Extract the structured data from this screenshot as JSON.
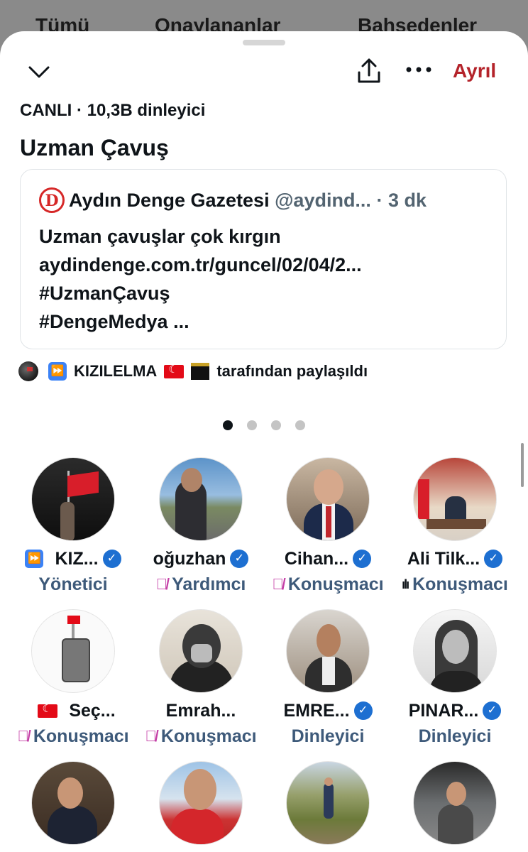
{
  "background_tabs": [
    "Tümü",
    "Onaylananlar",
    "Bahsedenler"
  ],
  "header": {
    "leave_label": "Ayrıl",
    "status": "CANLI · 10,3B dinleyici",
    "title": "Uzman Çavuş"
  },
  "pinned_post": {
    "author_name": "Aydın Denge Gazetesi",
    "author_handle": "@aydind...",
    "time": "· 3 dk",
    "logo_letter": "D",
    "lines": [
      "Uzman çavuşlar çok kırgın",
      "aydindenge.com.tr/guncel/02/04/2...",
      "#UzmanÇavuş",
      "#DengeMedya ..."
    ]
  },
  "shared_by": {
    "name": "KIZILELMA",
    "suffix": "tarafından paylaşıldı"
  },
  "pager": {
    "count": 4,
    "active": 0
  },
  "participants": [
    {
      "name": "KIZ...",
      "role": "Yönetici",
      "verified": true,
      "ff_prefix": true,
      "flag_prefix": false,
      "icon": "none"
    },
    {
      "name": "oğuzhan",
      "role": "Yardımcı",
      "verified": true,
      "ff_prefix": false,
      "flag_prefix": false,
      "icon": "muted-mic"
    },
    {
      "name": "Cihan...",
      "role": "Konuşmacı",
      "verified": true,
      "ff_prefix": false,
      "flag_prefix": false,
      "icon": "muted-mic"
    },
    {
      "name": "Ali Tilk...",
      "role": "Konuşmacı",
      "verified": true,
      "ff_prefix": false,
      "flag_prefix": false,
      "icon": "speaking"
    },
    {
      "name": "Seç...",
      "role": "Konuşmacı",
      "verified": false,
      "ff_prefix": false,
      "flag_prefix": true,
      "icon": "muted-mic"
    },
    {
      "name": "Emrah...",
      "role": "Konuşmacı",
      "verified": false,
      "ff_prefix": false,
      "flag_prefix": false,
      "icon": "muted-mic"
    },
    {
      "name": "EMRE...",
      "role": "Dinleyici",
      "verified": true,
      "ff_prefix": false,
      "flag_prefix": false,
      "icon": "none"
    },
    {
      "name": "PINAR...",
      "role": "Dinleyici",
      "verified": true,
      "ff_prefix": false,
      "flag_prefix": false,
      "icon": "none"
    },
    {
      "name": "",
      "role": "",
      "verified": false,
      "ff_prefix": false,
      "flag_prefix": false,
      "icon": "none"
    },
    {
      "name": "",
      "role": "",
      "verified": false,
      "ff_prefix": false,
      "flag_prefix": false,
      "icon": "none"
    },
    {
      "name": "",
      "role": "",
      "verified": false,
      "ff_prefix": false,
      "flag_prefix": false,
      "icon": "none"
    },
    {
      "name": "",
      "role": "",
      "verified": false,
      "ff_prefix": false,
      "flag_prefix": false,
      "icon": "none"
    }
  ],
  "colors": {
    "leave": "#b4232a",
    "verified": "#1d6fd1",
    "role_text": "#3e5a7a",
    "muted_mic": "#c43fa6"
  },
  "icons": [
    "chevron-down-icon",
    "share-icon",
    "more-icon",
    "verified-badge-icon",
    "muted-mic-icon",
    "speaking-icon",
    "turkish-flag-icon",
    "kaaba-icon",
    "fast-forward-icon"
  ]
}
